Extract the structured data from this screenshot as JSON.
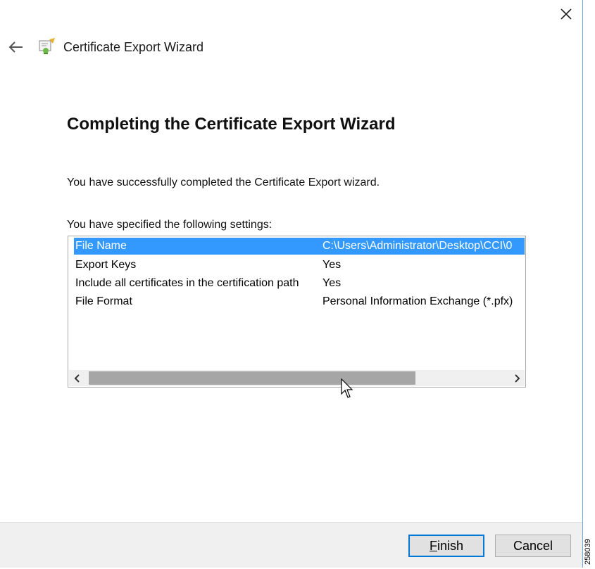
{
  "window": {
    "title": "Certificate Export Wizard",
    "icons": {
      "close": "close-icon",
      "back": "back-arrow-icon",
      "app": "certificate-wizard-icon"
    }
  },
  "content": {
    "heading": "Completing the Certificate Export Wizard",
    "success_message": "You have successfully completed the Certificate Export wizard.",
    "settings_label": "You have specified the following settings:"
  },
  "settings": {
    "rows": [
      {
        "key": "File Name",
        "value": "C:\\Users\\Administrator\\Desktop\\CCI\\0",
        "selected": true
      },
      {
        "key": "Export Keys",
        "value": "Yes",
        "selected": false
      },
      {
        "key": "Include all certificates in the certification path",
        "value": "Yes",
        "selected": false
      },
      {
        "key": "File Format",
        "value": "Personal Information Exchange (*.pfx)",
        "selected": false
      }
    ],
    "scroll_position": 0.72
  },
  "buttons": {
    "finish": "Finish",
    "cancel": "Cancel"
  },
  "figure_id": "258039",
  "colors": {
    "selection": "#3399ff",
    "default_button_border": "#0078d7",
    "footer_bg": "#f0f0f0"
  }
}
